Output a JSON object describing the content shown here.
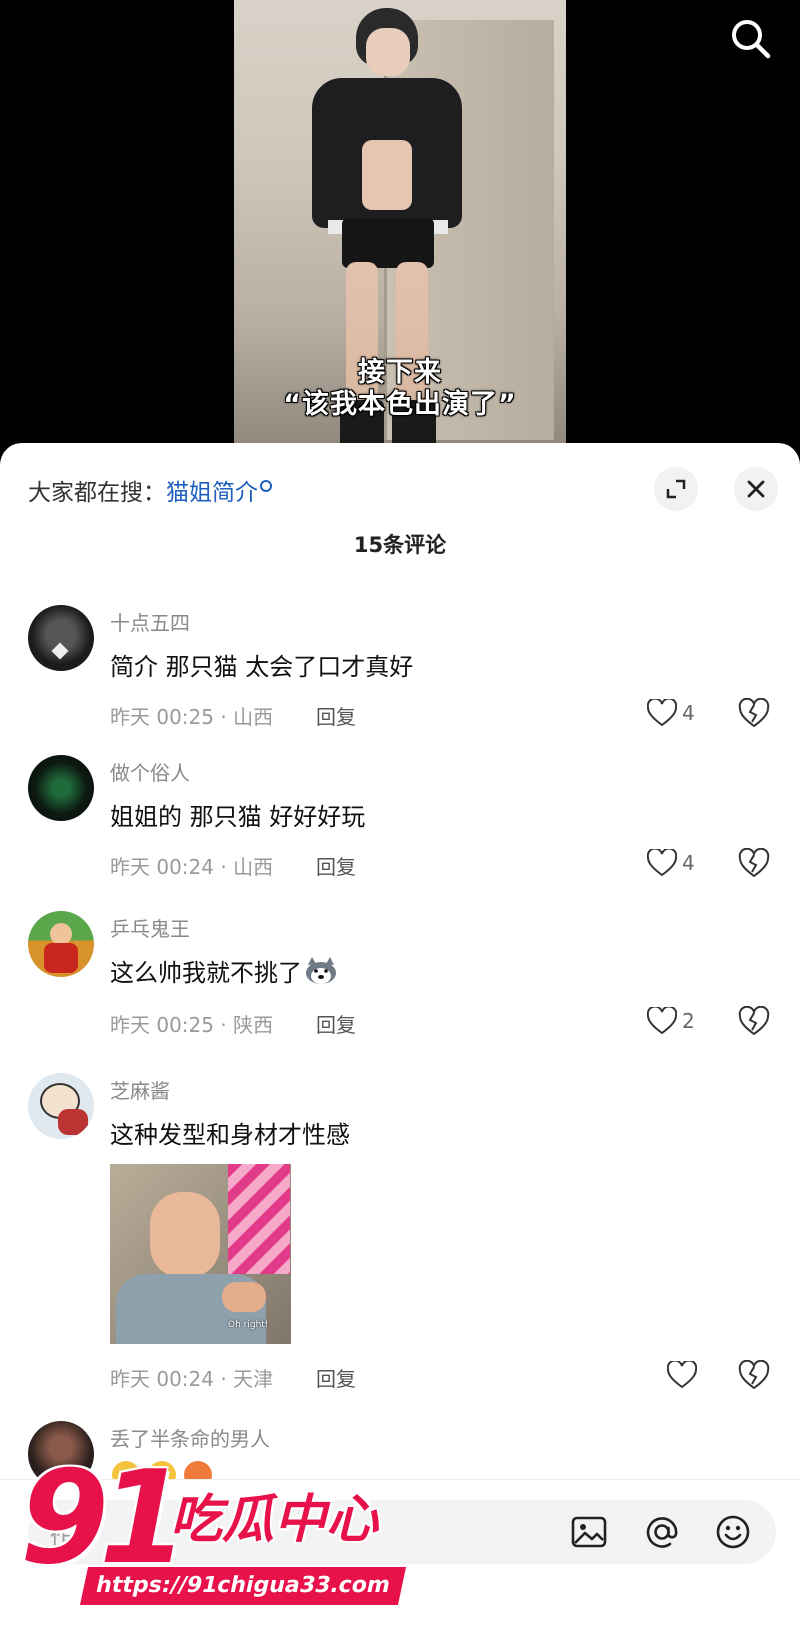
{
  "video": {
    "caption_line1": "接下来",
    "caption_line2": "“该我本色出演了”"
  },
  "top_bar": {
    "search_icon": "search-icon"
  },
  "sheet": {
    "trending_prefix": "大家都在搜：",
    "trending_keyword": "猫姐简介",
    "comment_count": "15条评论",
    "expand_icon": "expand-icon",
    "close_icon": "close-icon"
  },
  "comments": [
    {
      "user": "十点五四",
      "text": "简介 那只猫 太会了口才真好",
      "time": "昨天 00:25 · 山西",
      "reply": "回复",
      "likes": "4"
    },
    {
      "user": "做个俗人",
      "text": "姐姐的 那只猫 好好好玩",
      "time": "昨天 00:24 · 山西",
      "reply": "回复",
      "likes": "4"
    },
    {
      "user": "乒乓鬼王",
      "text": "这么帅我就不挑了",
      "time": "昨天 00:25 · 陕西",
      "reply": "回复",
      "likes": "2",
      "emoji_icon": "husky-emoji-icon"
    },
    {
      "user": "芝麻酱",
      "text": "这种发型和身材才性感",
      "time": "昨天 00:24 · 天津",
      "reply": "回复",
      "likes": "",
      "image_caption": "Oh right!"
    },
    {
      "user": "丢了半条命的男人",
      "text": "",
      "time": "",
      "reply": "",
      "likes": ""
    }
  ],
  "input_bar": {
    "placeholder": "作者",
    "image_icon": "image-icon",
    "mention_icon": "at-mention-icon",
    "emoji_icon": "emoji-face-icon"
  },
  "watermark": {
    "number": "91",
    "title": "吃瓜中心",
    "url": "https://91chigua33.com"
  },
  "colors": {
    "accent_blue": "#1f5fbf",
    "watermark_red": "#e8124b"
  }
}
